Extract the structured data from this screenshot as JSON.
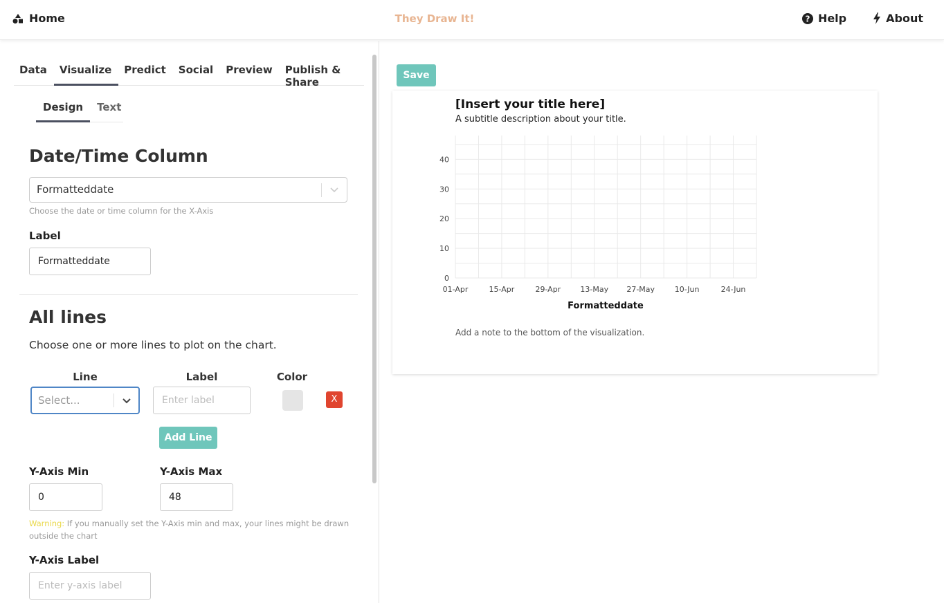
{
  "nav": {
    "home": "Home",
    "brand": "They Draw It!",
    "help": "Help",
    "about": "About"
  },
  "tabs": [
    {
      "label": "Data"
    },
    {
      "label": "Visualize"
    },
    {
      "label": "Predict"
    },
    {
      "label": "Social"
    },
    {
      "label": "Preview"
    },
    {
      "label": "Publish & Share"
    }
  ],
  "subtabs": [
    {
      "label": "Design"
    },
    {
      "label": "Text"
    }
  ],
  "datetime": {
    "heading": "Date/Time Column",
    "selected": "Formatteddate",
    "hint": "Choose the date or time column for the X-Axis",
    "label_heading": "Label",
    "label_value": "Formatteddate"
  },
  "lines": {
    "heading": "All lines",
    "description": "Choose one or more lines to plot on the chart.",
    "col_line": "Line",
    "col_label": "Label",
    "col_color": "Color",
    "line_placeholder": "Select...",
    "label_placeholder": "Enter label",
    "remove": "X",
    "add_button": "Add Line"
  },
  "yaxis": {
    "min_label": "Y-Axis Min",
    "min_value": "0",
    "max_label": "Y-Axis Max",
    "max_value": "48",
    "warning_prefix": "Warning:",
    "warning_text": " If you manually set the Y-Axis min and max, your lines might be drawn outside the chart",
    "label_heading": "Y-Axis Label",
    "label_placeholder": "Enter y-axis label"
  },
  "preview": {
    "save": "Save",
    "title": "[Insert your title here]",
    "subtitle": "A subtitle description about your title.",
    "note": "Add a note to the bottom of the visualization."
  },
  "chart_data": {
    "type": "line",
    "categories": [
      "01-Apr",
      "15-Apr",
      "29-Apr",
      "13-May",
      "27-May",
      "10-Jun",
      "24-Jun"
    ],
    "series": [],
    "xlabel": "Formatteddate",
    "ylabel": "",
    "y_ticks": [
      0,
      10,
      20,
      30,
      40
    ],
    "ylim": [
      0,
      48
    ],
    "grid": true
  }
}
